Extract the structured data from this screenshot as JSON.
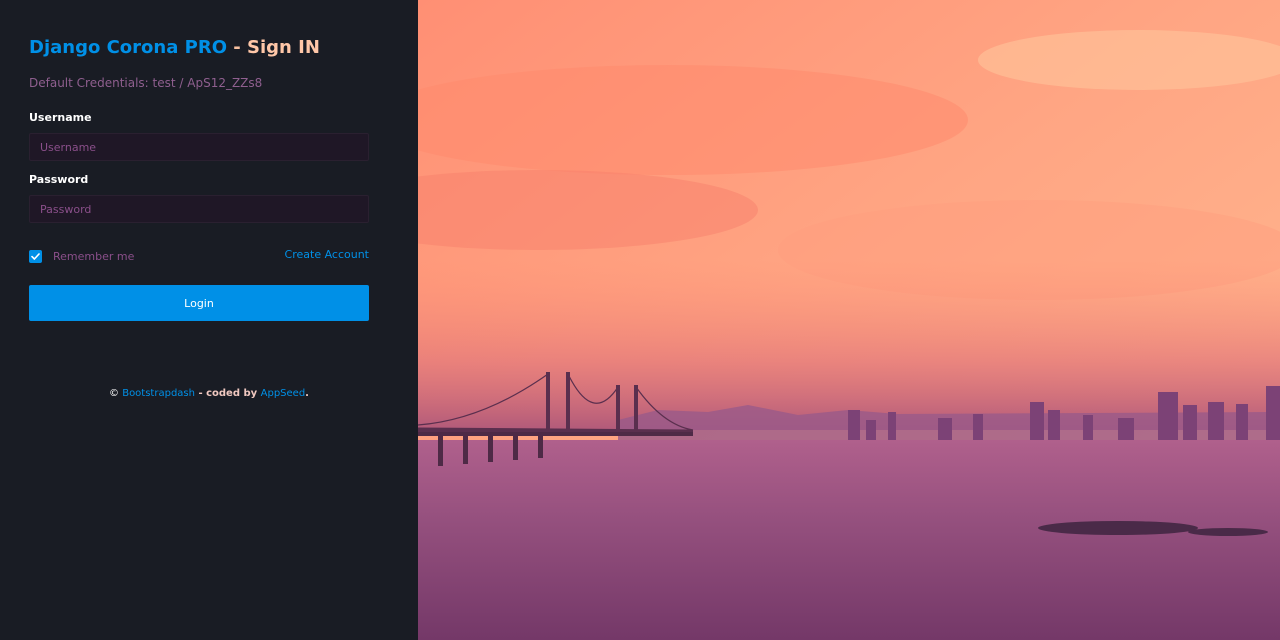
{
  "header": {
    "brand": "Django Corona PRO",
    "separator": " - ",
    "action": "Sign IN"
  },
  "credentials_note": "Default Credentials: test / ApS12_ZZs8",
  "form": {
    "username_label": "Username",
    "username_placeholder": "Username",
    "password_label": "Password",
    "password_placeholder": "Password",
    "remember_label": "Remember me",
    "remember_checked": true,
    "create_account_label": "Create Account",
    "login_label": "Login"
  },
  "footer": {
    "copyright_symbol": "©",
    "author_link": "Bootstrapdash",
    "coded_by": " - coded by ",
    "coder_link": "AppSeed",
    "end": "."
  },
  "colors": {
    "panel_bg": "#191c24",
    "accent": "#0090e7",
    "sky_top": "#ffbf94",
    "sky_mid": "#ff8a70",
    "water": "#7a3a6e"
  },
  "background_image": "city-bridge-sunset-scene"
}
